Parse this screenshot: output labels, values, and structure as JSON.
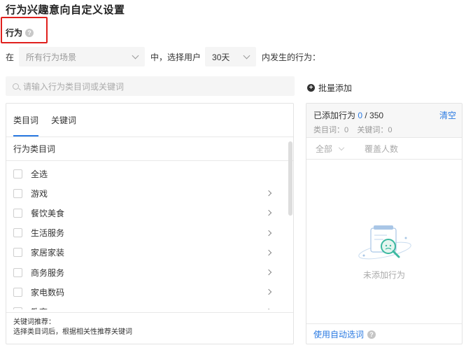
{
  "page": {
    "title": "行为兴趣意向自定义设置",
    "section_label": "行为"
  },
  "filter": {
    "prefix": "在",
    "scene_placeholder": "所有行为场景",
    "middle": "中，选择用户",
    "days_value": "30天",
    "suffix": "内发生的行为："
  },
  "search": {
    "placeholder": "请输入行为类目词或关键词"
  },
  "batch_add_label": "批量添加",
  "left_panel": {
    "tabs": [
      {
        "label": "类目词",
        "active": true
      },
      {
        "label": "关键词",
        "active": false
      }
    ],
    "column_header": "行为类目词",
    "items": [
      {
        "label": "全选",
        "has_arrow": false
      },
      {
        "label": "游戏",
        "has_arrow": true
      },
      {
        "label": "餐饮美食",
        "has_arrow": true
      },
      {
        "label": "生活服务",
        "has_arrow": true
      },
      {
        "label": "家居家装",
        "has_arrow": true
      },
      {
        "label": "商务服务",
        "has_arrow": true
      },
      {
        "label": "家电数码",
        "has_arrow": true
      },
      {
        "label": "教育",
        "has_arrow": true
      }
    ],
    "recommend_title": "关键词推荐：",
    "recommend_desc": "选择类目词后，根据相关性推荐关键词"
  },
  "right_panel": {
    "added_prefix": "已添加行为 ",
    "added_count": "0",
    "added_total": " / 350",
    "clear_label": "清空",
    "counts_line": "类目词：0    关键词：0",
    "filter_all": "全部",
    "filter_coverage": "覆盖人数",
    "empty_text": "未添加行为",
    "auto_select_label": "使用自动选词"
  },
  "colors": {
    "accent": "#2a7ae2",
    "highlight_border": "#e0201d"
  }
}
